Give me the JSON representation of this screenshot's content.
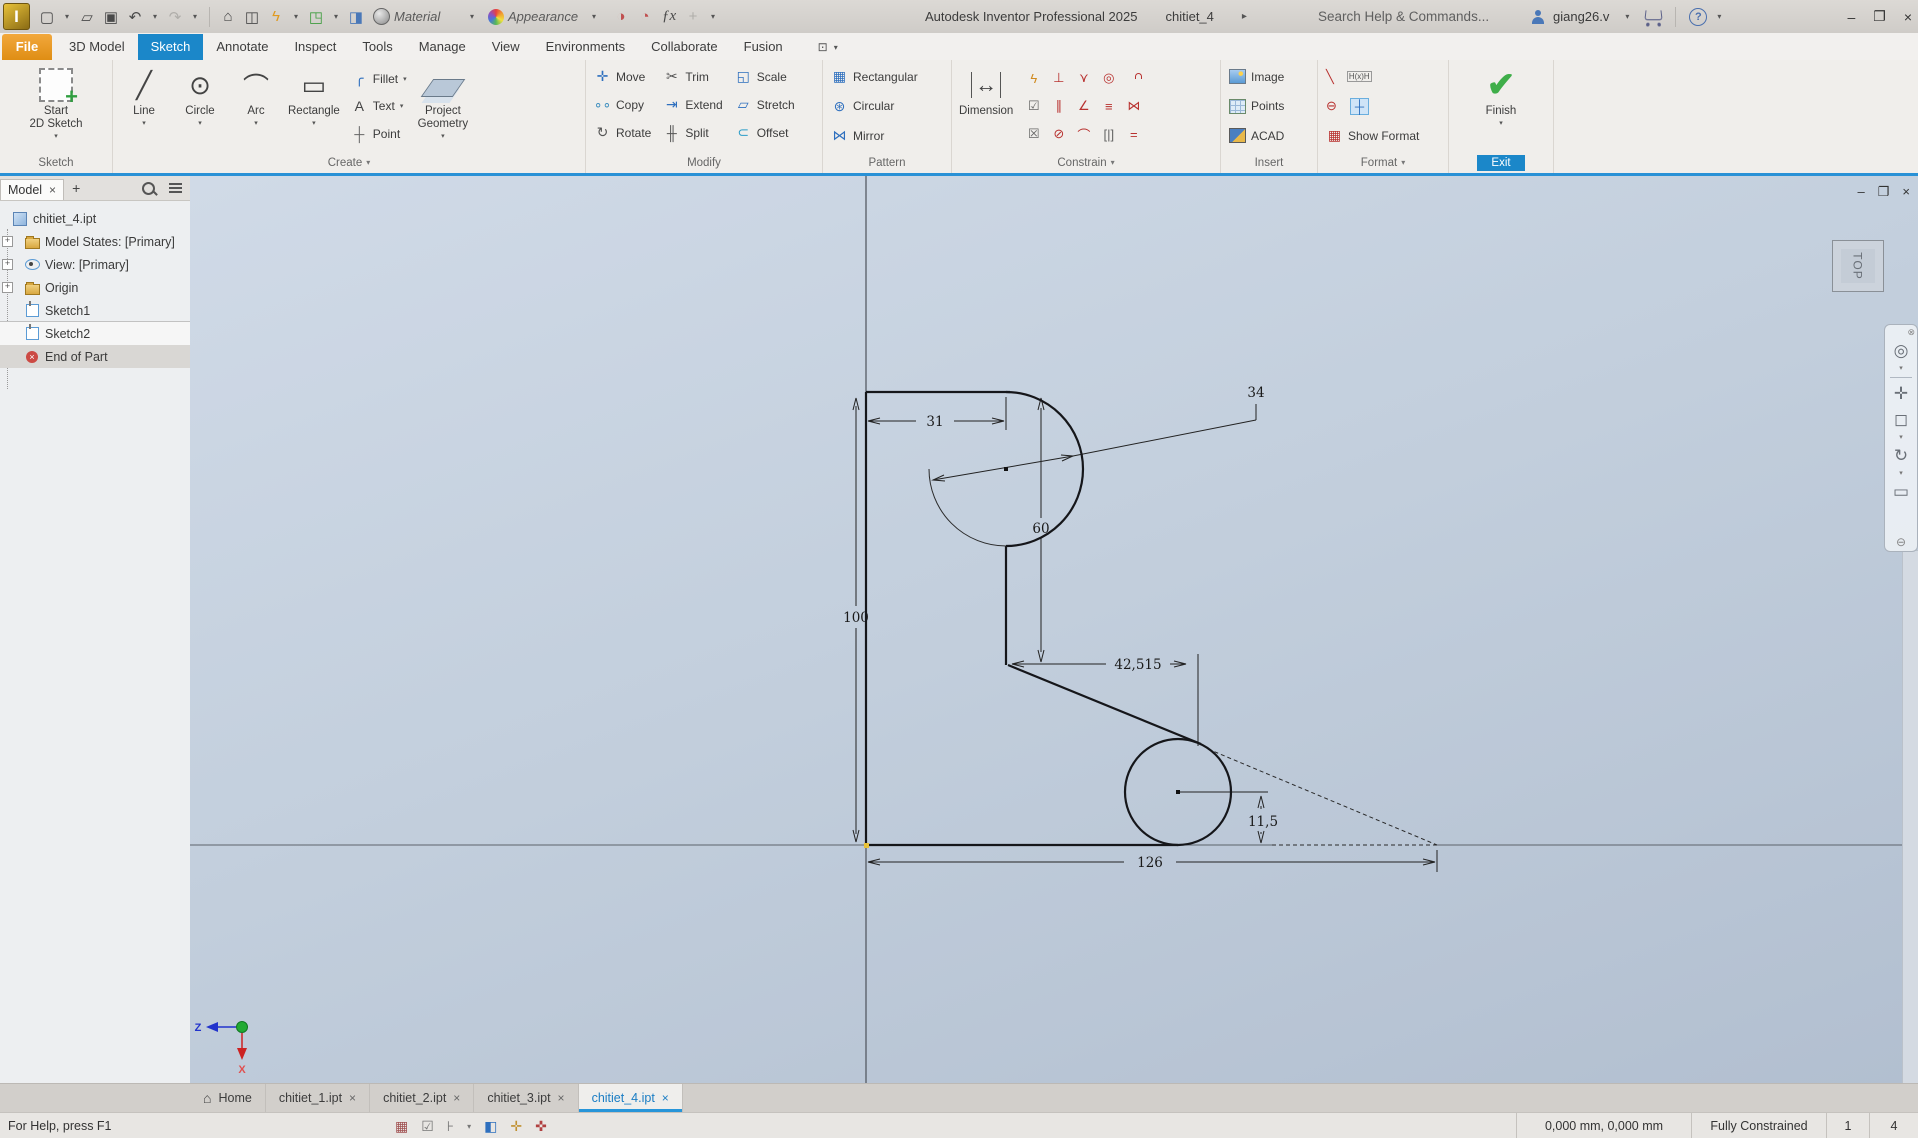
{
  "colors": {
    "accent_blue": "#1b87c9",
    "file_orange": "#e9941f",
    "constraint_red": "#b8312f",
    "finish_green": "#3fae49"
  },
  "icons": {
    "caret-down": "▾",
    "caret-right": "▸",
    "new-file": "▢",
    "open-file": "▱",
    "save": "▣",
    "undo": "↶",
    "redo": "↷",
    "home": "⌂",
    "paste": "◫",
    "quick-command": "ϟ",
    "drawing-zone": "◳",
    "push-pair": "◨",
    "adjust-material": "◑",
    "clear-material": "◔",
    "fx": "ƒx",
    "add": "+",
    "line": "╱",
    "circle": "⊙",
    "arc": "⌒",
    "rectangle": "▭",
    "fillet": "╭",
    "text": "A",
    "point": "┼",
    "move": "✛",
    "copy": "∘∘",
    "rotate": "↻",
    "trim": "✂",
    "extend": "⇥",
    "split": "╫",
    "scale": "◱",
    "stretch": "▱",
    "offset": "⊂",
    "rect-pattern": "▦",
    "circ-pattern": "⊛",
    "mirror": "⋈",
    "dimension": "↔",
    "auto-dim": "ϟ",
    "perpendicular": "⊥",
    "coincident": "⋎",
    "concentric": "◎",
    "parallel": "∥",
    "angle": "∠",
    "collinear": "≡",
    "symmetric": "⋈",
    "show-constraints": "☑",
    "delete-constraints": "☒",
    "tangent": "⊘",
    "smooth": "⌒",
    "brackets": "[|]",
    "equal": "=",
    "finish": "✔",
    "centerline-slash": "╲",
    "driven-dim": "H(x)H",
    "centerline": "⊖",
    "center-point": "┼",
    "window-min": "–",
    "window-restore": "❐",
    "window-close": "×",
    "wheel": "◎",
    "pan": "✛",
    "zoom-window": "◻",
    "orbit": "↻",
    "look-at": "▭",
    "nav-close": "⊗",
    "nav-minus": "⊖",
    "ribbon-display": "⊡",
    "grid-snap": "▦",
    "constraint-visibility": "☑",
    "dim-display": "⊦",
    "slice": "◧",
    "dof": "✛",
    "relax": "✜",
    "close": "×"
  },
  "title_bar": {
    "app_logo": "I",
    "material_label": "Material",
    "appearance_label": "Appearance",
    "title": "Autodesk Inventor Professional 2025",
    "document_name": "chitiet_4",
    "search_placeholder": "Search Help & Commands...",
    "user_name": "giang26.v"
  },
  "ribbon": {
    "tabs": [
      "File",
      "3D Model",
      "Sketch",
      "Annotate",
      "Inspect",
      "Tools",
      "Manage",
      "View",
      "Environments",
      "Collaborate",
      "Fusion"
    ],
    "active_tab": "Sketch",
    "sketch_panel": {
      "label": "Sketch",
      "start_button": [
        "Start",
        "2D Sketch"
      ]
    },
    "create_panel": {
      "label": "Create",
      "big_buttons": [
        "Line",
        "Circle",
        "Arc",
        "Rectangle"
      ],
      "stack_buttons": [
        "Fillet",
        "Text",
        "Point"
      ],
      "project_button": [
        "Project",
        "Geometry"
      ]
    },
    "modify_panel": {
      "label": "Modify",
      "buttons": [
        "Move",
        "Copy",
        "Rotate",
        "Trim",
        "Extend",
        "Split",
        "Scale",
        "Stretch",
        "Offset"
      ]
    },
    "pattern_panel": {
      "label": "Pattern",
      "buttons": [
        "Rectangular",
        "Circular",
        "Mirror"
      ]
    },
    "constrain_panel": {
      "label": "Constrain",
      "dimension_label": "Dimension",
      "constraint_icons": [
        "auto-dim",
        "perpendicular",
        "coincident",
        "concentric",
        "lock",
        "show-constraints",
        "parallel",
        "angle",
        "collinear",
        "symmetric",
        "delete-constraints",
        "tangent",
        "smooth",
        "brackets",
        "equal"
      ]
    },
    "insert_panel": {
      "label": "Insert",
      "buttons": [
        "Image",
        "Points",
        "ACAD"
      ]
    },
    "format_panel": {
      "label": "Format",
      "show_format_label": "Show Format"
    },
    "exit_panel": {
      "label": "Exit",
      "finish_label": "Finish"
    }
  },
  "browser": {
    "tab_label": "Model",
    "items": [
      {
        "label": "chitiet_4.ipt",
        "icon": "part",
        "indent": 0,
        "expander": false
      },
      {
        "label": "Model States: [Primary]",
        "icon": "folder",
        "indent": 1,
        "expander": true
      },
      {
        "label": "View: [Primary]",
        "icon": "eye",
        "indent": 1,
        "expander": true
      },
      {
        "label": "Origin",
        "icon": "folder",
        "indent": 1,
        "expander": true
      },
      {
        "label": "Sketch1",
        "icon": "sketch",
        "indent": 1,
        "expander": false
      },
      {
        "label": "Sketch2",
        "icon": "sketch",
        "indent": 1,
        "expander": false,
        "selected": true
      },
      {
        "label": "End of Part",
        "icon": "end",
        "indent": 1,
        "expander": false,
        "end_marker": true
      }
    ]
  },
  "canvas": {
    "viewcube_label": "TOP",
    "triad": {
      "z_label": "Z",
      "x_label": "X"
    },
    "dimensions": {
      "top_width": "31",
      "circle_diameter": "34",
      "step_height": "60",
      "total_height": "100",
      "step_width": "42,515",
      "center_offset": "11,5",
      "base_width": "126"
    }
  },
  "bottom_tabs": [
    {
      "label": "Home",
      "home_icon": true,
      "closable": false,
      "active": false
    },
    {
      "label": "chitiet_1.ipt",
      "closable": true,
      "active": false
    },
    {
      "label": "chitiet_2.ipt",
      "closable": true,
      "active": false
    },
    {
      "label": "chitiet_3.ipt",
      "closable": true,
      "active": false
    },
    {
      "label": "chitiet_4.ipt",
      "closable": true,
      "active": true
    }
  ],
  "status_bar": {
    "help_text": "For Help, press F1",
    "coordinates": "0,000 mm, 0,000 mm",
    "constraint_status": "Fully Constrained",
    "sketch_number": "1",
    "dimension_count": "4"
  }
}
